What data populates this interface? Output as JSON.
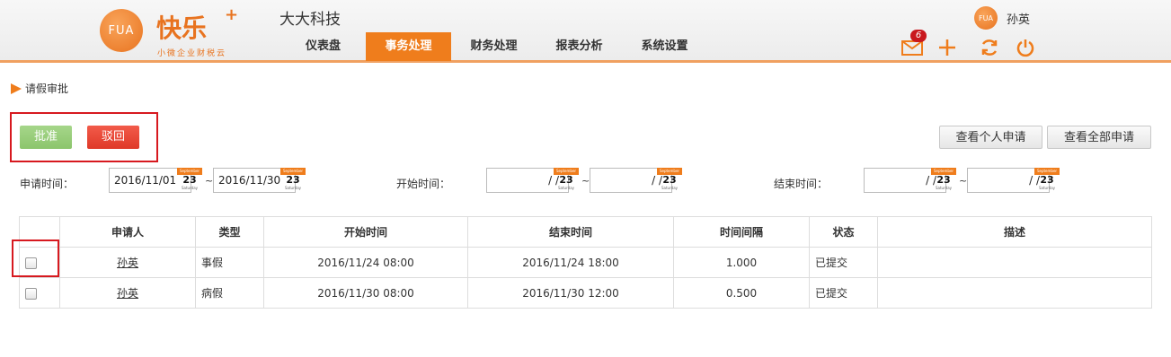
{
  "header": {
    "logo_mark": "FUA",
    "logo_title": "快乐",
    "logo_plus": "+",
    "logo_subtitle": "小微企业财税云",
    "company_name": "大大科技",
    "nav": [
      {
        "label": "仪表盘",
        "active": false
      },
      {
        "label": "事务处理",
        "active": true
      },
      {
        "label": "财务处理",
        "active": false
      },
      {
        "label": "报表分析",
        "active": false
      },
      {
        "label": "系统设置",
        "active": false
      }
    ],
    "user": {
      "avatar_text": "FUA",
      "name": "孙英"
    },
    "message_count": "6",
    "accent_color": "#ef7d1c"
  },
  "breadcrumb": {
    "label": "请假审批"
  },
  "actions": {
    "approve_label": "批准",
    "revoke_label": "驳回",
    "view_personal_label": "查看个人申请",
    "view_all_label": "查看全部申请"
  },
  "filters": {
    "apply_time": {
      "label": "申请时间：",
      "from": "2016/11/01",
      "to": "2016/11/30"
    },
    "start_time": {
      "label": "开始时间：",
      "from": "/ /",
      "to": "/ /"
    },
    "end_time": {
      "label": "结束时间：",
      "from": "/ /",
      "to": "/ /"
    },
    "tilde": "~",
    "calendar": {
      "month": "September",
      "day": "23",
      "weekday": "Saturday"
    }
  },
  "table": {
    "columns": [
      "",
      "申请人",
      "类型",
      "开始时间",
      "结束时间",
      "时间间隔",
      "状态",
      "描述"
    ],
    "rows": [
      {
        "applicant": "孙英",
        "type": "事假",
        "start": "2016/11/24 08:00",
        "end": "2016/11/24 18:00",
        "interval": "1.000",
        "status": "已提交",
        "desc": ""
      },
      {
        "applicant": "孙英",
        "type": "病假",
        "start": "2016/11/30 08:00",
        "end": "2016/11/30 12:00",
        "interval": "0.500",
        "status": "已提交",
        "desc": ""
      }
    ]
  }
}
